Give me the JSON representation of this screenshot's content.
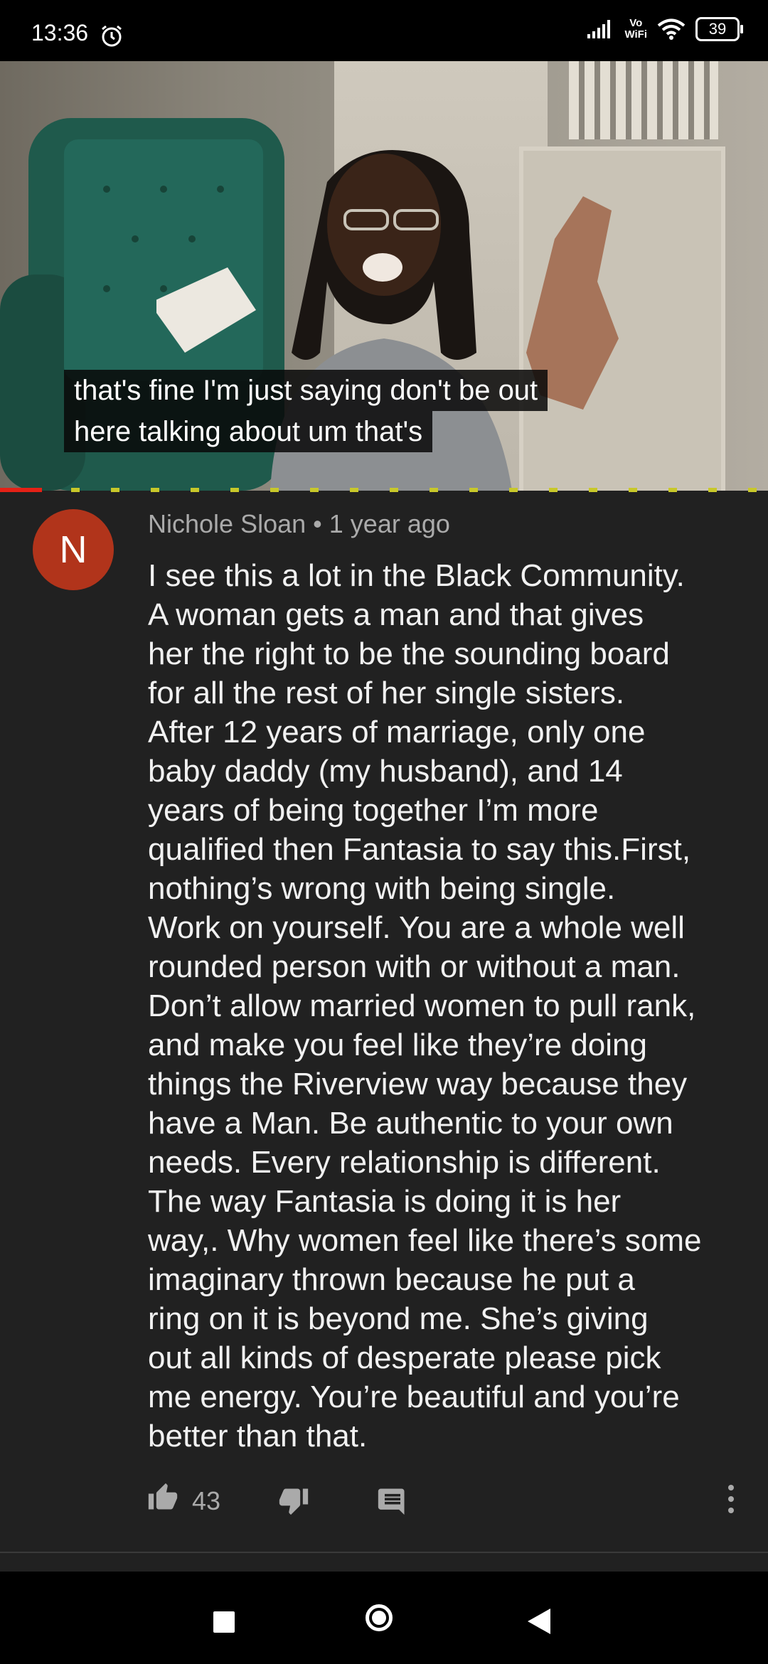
{
  "status_bar": {
    "time": "13:36",
    "vowifi_top": "Vo",
    "vowifi_bottom": "WiFi",
    "battery": "39"
  },
  "video": {
    "caption_lines": [
      "that's fine I'm just saying don't be out",
      "here talking about um that's"
    ],
    "progress_fraction": 0.055,
    "progress_color": "#e52116"
  },
  "comment": {
    "avatar_letter": "N",
    "avatar_color": "#b1341b",
    "author": "Nichole Sloan",
    "separator": "•",
    "time_ago": "1 year ago",
    "body_lines": [
      "I see this a lot in the Black Community.",
      "A woman gets a man and that gives",
      "her the right to be the sounding board",
      "for all the rest of her single sisters.",
      "After 12 years of marriage, only one",
      "baby daddy (my husband), and 14",
      "years of being together I’m more",
      "qualified then Fantasia to say this.First,",
      "nothing’s wrong with being single.",
      "Work on yourself. You are a whole well",
      "rounded person with or without a man.",
      "Don’t allow married women to pull rank,",
      "and make you feel like they’re doing",
      "things the Riverview way because they",
      "have a Man. Be authentic to your own",
      "needs. Every relationship is different.",
      "The way Fantasia is doing it is her",
      "way,. Why women feel like there’s some",
      "imaginary thrown because he put a",
      "ring on it is beyond me. She’s giving",
      "out all kinds of desperate please pick",
      "me energy. You’re beautiful and you’re",
      "better than that."
    ],
    "like_count": "43"
  },
  "icons": {
    "alarm": "alarm-clock-icon",
    "signal": "signal-icon",
    "wifi": "wifi-icon",
    "like": "thumbs-up-icon",
    "dislike": "thumbs-down-icon",
    "reply": "reply-icon",
    "more": "more-vert-icon",
    "recents": "recents-square-icon",
    "home": "home-circle-icon",
    "back": "back-triangle-icon"
  }
}
